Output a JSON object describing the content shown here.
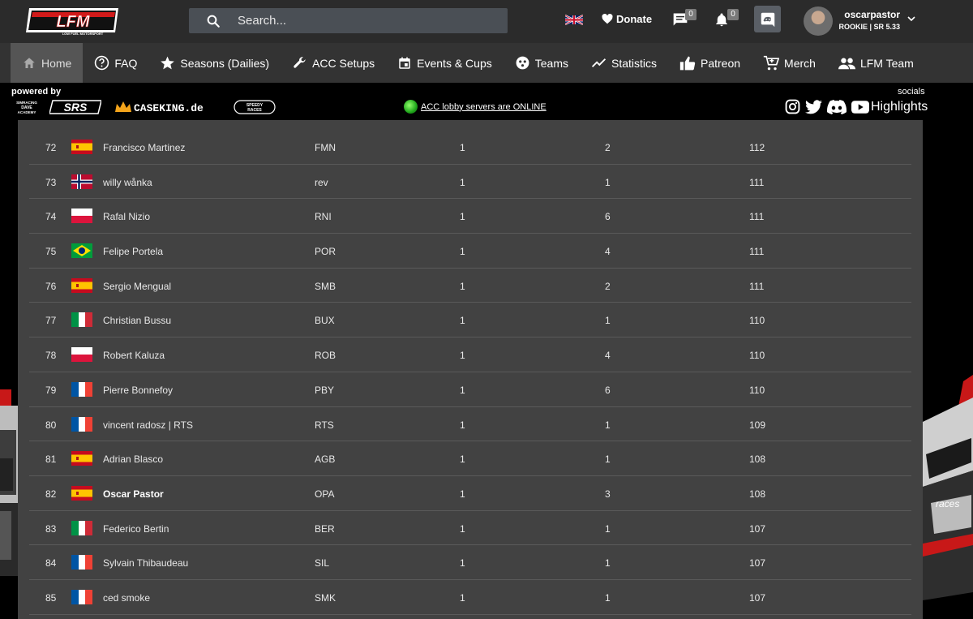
{
  "brand": {
    "logo_text": "LFM",
    "logo_sub": "LOW FUEL MOTORSPORT"
  },
  "search": {
    "placeholder": "Search..."
  },
  "header": {
    "donate_label": "Donate",
    "messages_count": "0",
    "notifications_count": "0",
    "username": "oscarpastor",
    "user_rank": "ROOKIE | SR 5.33"
  },
  "nav": {
    "items": [
      {
        "label": "Home",
        "icon": "home-icon"
      },
      {
        "label": "FAQ",
        "icon": "help-icon"
      },
      {
        "label": "Seasons (Dailies)",
        "icon": "star-icon"
      },
      {
        "label": "ACC Setups",
        "icon": "wrench-icon"
      },
      {
        "label": "Events & Cups",
        "icon": "calendar-icon"
      },
      {
        "label": "Teams",
        "icon": "teams-icon"
      },
      {
        "label": "Statistics",
        "icon": "chart-icon"
      },
      {
        "label": "Patreon",
        "icon": "thumbs-up-icon"
      },
      {
        "label": "Merch",
        "icon": "cart-icon"
      },
      {
        "label": "LFM Team",
        "icon": "people-icon"
      }
    ]
  },
  "sponsors": {
    "powered_by": "powered by",
    "logos": [
      "SIMRACING DAVE ACADEMY",
      "SRS",
      "CASEKING.de",
      "SPEEDY RACES"
    ],
    "lobby_status": "ACC lobby servers are ONLINE",
    "socials_label": "socials",
    "highlights": "Highlights"
  },
  "table": {
    "rows": [
      {
        "pos": "72",
        "country": "es",
        "name": "Francisco Martinez",
        "tag": "FMN",
        "a": "1",
        "b": "2",
        "pts": "112"
      },
      {
        "pos": "73",
        "country": "no",
        "name": "willy wånka",
        "tag": "rev",
        "a": "1",
        "b": "1",
        "pts": "111"
      },
      {
        "pos": "74",
        "country": "pl",
        "name": "Rafal Nizio",
        "tag": "RNI",
        "a": "1",
        "b": "6",
        "pts": "111"
      },
      {
        "pos": "75",
        "country": "br",
        "name": "Felipe Portela",
        "tag": "POR",
        "a": "1",
        "b": "4",
        "pts": "111"
      },
      {
        "pos": "76",
        "country": "es",
        "name": "Sergio Mengual",
        "tag": "SMB",
        "a": "1",
        "b": "2",
        "pts": "111"
      },
      {
        "pos": "77",
        "country": "it",
        "name": "Christian Bussu",
        "tag": "BUX",
        "a": "1",
        "b": "1",
        "pts": "110"
      },
      {
        "pos": "78",
        "country": "pl",
        "name": "Robert Kaluza",
        "tag": "ROB",
        "a": "1",
        "b": "4",
        "pts": "110"
      },
      {
        "pos": "79",
        "country": "fr",
        "name": "Pierre Bonnefoy",
        "tag": "PBY",
        "a": "1",
        "b": "6",
        "pts": "110"
      },
      {
        "pos": "80",
        "country": "fr",
        "name": "vincent radosz | RTS",
        "tag": "RTS",
        "a": "1",
        "b": "1",
        "pts": "109"
      },
      {
        "pos": "81",
        "country": "es",
        "name": "Adrian Blasco",
        "tag": "AGB",
        "a": "1",
        "b": "1",
        "pts": "108"
      },
      {
        "pos": "82",
        "country": "es",
        "name": "Oscar Pastor",
        "tag": "OPA",
        "a": "1",
        "b": "3",
        "pts": "108",
        "highlight": true
      },
      {
        "pos": "83",
        "country": "it",
        "name": "Federico Bertin",
        "tag": "BER",
        "a": "1",
        "b": "1",
        "pts": "107"
      },
      {
        "pos": "84",
        "country": "fr",
        "name": "Sylvain Thibaudeau",
        "tag": "SIL",
        "a": "1",
        "b": "1",
        "pts": "107"
      },
      {
        "pos": "85",
        "country": "fr",
        "name": "ced smoke",
        "tag": "SMK",
        "a": "1",
        "b": "1",
        "pts": "107"
      }
    ]
  },
  "colors": {
    "topbar": "#2b2b2b",
    "nav": "#333333",
    "nav_active": "#555555",
    "panel": "#424242",
    "accent_red": "#d11a1a",
    "online_green": "#1fa51b"
  }
}
